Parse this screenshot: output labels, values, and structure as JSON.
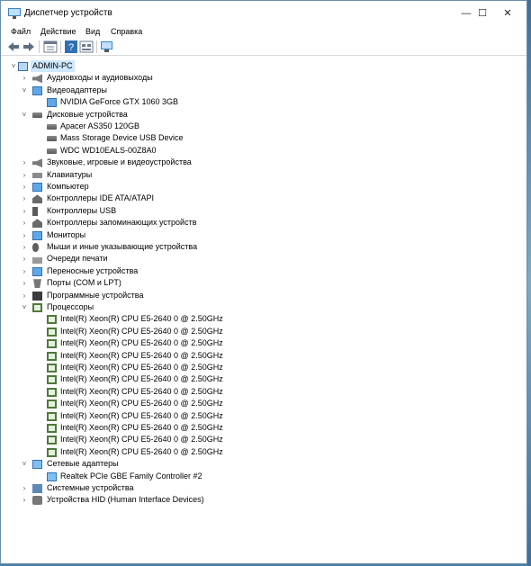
{
  "window": {
    "title": "Диспетчер устройств"
  },
  "title_buttons": {
    "minimize": "—",
    "maximize": "☐",
    "close": "✕"
  },
  "menu": [
    "Файл",
    "Действие",
    "Вид",
    "Справка"
  ],
  "toolbar": [
    "back-icon",
    "forward-icon",
    "properties-icon",
    "help-icon",
    "show-hidden-icon",
    "scan-hardware-icon"
  ],
  "tree": [
    {
      "label": "ADMIN-PC",
      "level": 0,
      "expander": "˅",
      "icon": "pc",
      "selected": true
    },
    {
      "label": "Аудиовходы и аудиовыходы",
      "level": 1,
      "expander": "›",
      "icon": "speaker"
    },
    {
      "label": "Видеоадаптеры",
      "level": 1,
      "expander": "˅",
      "icon": "mon"
    },
    {
      "label": "NVIDIA GeForce GTX 1060 3GB",
      "level": 2,
      "expander": "",
      "icon": "mon"
    },
    {
      "label": "Дисковые устройства",
      "level": 1,
      "expander": "˅",
      "icon": "disk"
    },
    {
      "label": "Apacer AS350 120GB",
      "level": 2,
      "expander": "",
      "icon": "disk"
    },
    {
      "label": "Mass Storage Device USB Device",
      "level": 2,
      "expander": "",
      "icon": "disk"
    },
    {
      "label": "WDC WD10EALS-00Z8A0",
      "level": 2,
      "expander": "",
      "icon": "disk"
    },
    {
      "label": "Звуковые, игровые и видеоустройства",
      "level": 1,
      "expander": "›",
      "icon": "speaker"
    },
    {
      "label": "Клавиатуры",
      "level": 1,
      "expander": "›",
      "icon": "kbd"
    },
    {
      "label": "Компьютер",
      "level": 1,
      "expander": "›",
      "icon": "mon"
    },
    {
      "label": "Контроллеры IDE ATA/ATAPI",
      "level": 1,
      "expander": "›",
      "icon": "storage"
    },
    {
      "label": "Контроллеры USB",
      "level": 1,
      "expander": "›",
      "icon": "usb"
    },
    {
      "label": "Контроллеры запоминающих устройств",
      "level": 1,
      "expander": "›",
      "icon": "storage"
    },
    {
      "label": "Мониторы",
      "level": 1,
      "expander": "›",
      "icon": "mon"
    },
    {
      "label": "Мыши и иные указывающие устройства",
      "level": 1,
      "expander": "›",
      "icon": "mouse"
    },
    {
      "label": "Очереди печати",
      "level": 1,
      "expander": "›",
      "icon": "print"
    },
    {
      "label": "Переносные устройства",
      "level": 1,
      "expander": "›",
      "icon": "mon"
    },
    {
      "label": "Порты (COM и LPT)",
      "level": 1,
      "expander": "›",
      "icon": "port"
    },
    {
      "label": "Программные устройства",
      "level": 1,
      "expander": "›",
      "icon": "dark"
    },
    {
      "label": "Процессоры",
      "level": 1,
      "expander": "˅",
      "icon": "chip"
    },
    {
      "label": "Intel(R) Xeon(R) CPU E5-2640 0 @ 2.50GHz",
      "level": 2,
      "expander": "",
      "icon": "chip"
    },
    {
      "label": "Intel(R) Xeon(R) CPU E5-2640 0 @ 2.50GHz",
      "level": 2,
      "expander": "",
      "icon": "chip"
    },
    {
      "label": "Intel(R) Xeon(R) CPU E5-2640 0 @ 2.50GHz",
      "level": 2,
      "expander": "",
      "icon": "chip"
    },
    {
      "label": "Intel(R) Xeon(R) CPU E5-2640 0 @ 2.50GHz",
      "level": 2,
      "expander": "",
      "icon": "chip"
    },
    {
      "label": "Intel(R) Xeon(R) CPU E5-2640 0 @ 2.50GHz",
      "level": 2,
      "expander": "",
      "icon": "chip"
    },
    {
      "label": "Intel(R) Xeon(R) CPU E5-2640 0 @ 2.50GHz",
      "level": 2,
      "expander": "",
      "icon": "chip"
    },
    {
      "label": "Intel(R) Xeon(R) CPU E5-2640 0 @ 2.50GHz",
      "level": 2,
      "expander": "",
      "icon": "chip"
    },
    {
      "label": "Intel(R) Xeon(R) CPU E5-2640 0 @ 2.50GHz",
      "level": 2,
      "expander": "",
      "icon": "chip"
    },
    {
      "label": "Intel(R) Xeon(R) CPU E5-2640 0 @ 2.50GHz",
      "level": 2,
      "expander": "",
      "icon": "chip"
    },
    {
      "label": "Intel(R) Xeon(R) CPU E5-2640 0 @ 2.50GHz",
      "level": 2,
      "expander": "",
      "icon": "chip"
    },
    {
      "label": "Intel(R) Xeon(R) CPU E5-2640 0 @ 2.50GHz",
      "level": 2,
      "expander": "",
      "icon": "chip"
    },
    {
      "label": "Intel(R) Xeon(R) CPU E5-2640 0 @ 2.50GHz",
      "level": 2,
      "expander": "",
      "icon": "chip"
    },
    {
      "label": "Сетевые адаптеры",
      "level": 1,
      "expander": "˅",
      "icon": "net"
    },
    {
      "label": "Realtek PCIe GBE Family Controller #2",
      "level": 2,
      "expander": "",
      "icon": "net"
    },
    {
      "label": "Системные устройства",
      "level": 1,
      "expander": "›",
      "icon": "sys"
    },
    {
      "label": "Устройства HID (Human Interface Devices)",
      "level": 1,
      "expander": "›",
      "icon": "hid"
    }
  ]
}
